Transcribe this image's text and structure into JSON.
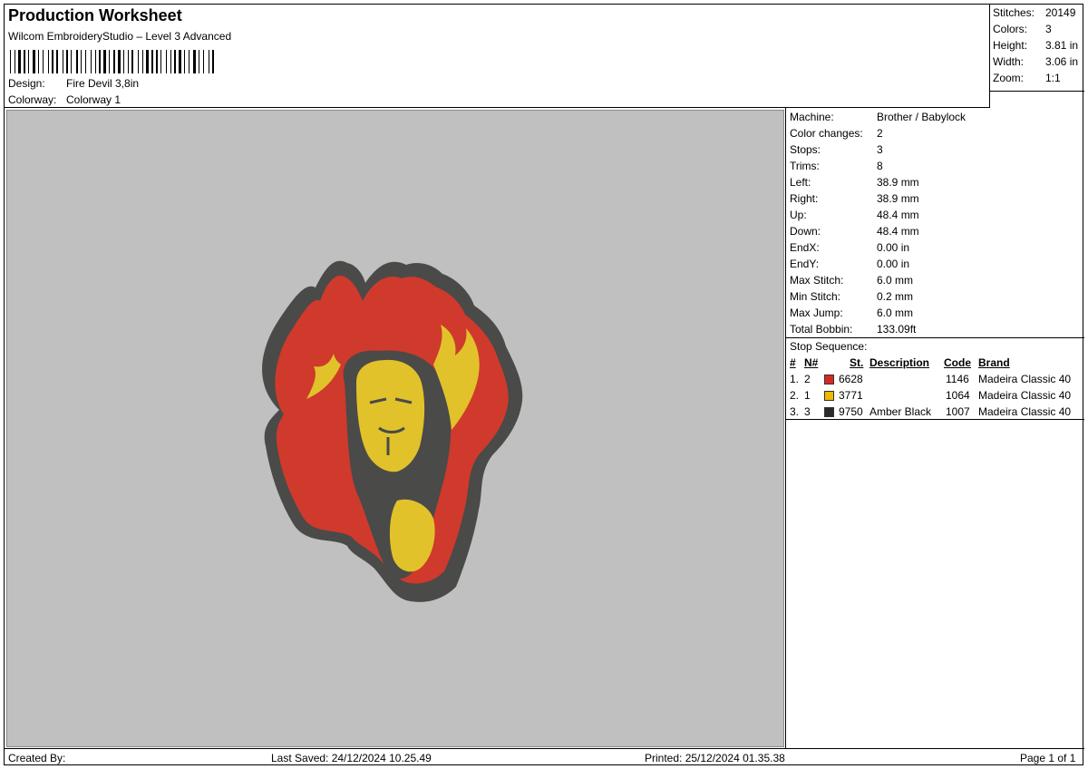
{
  "header": {
    "title": "Production Worksheet",
    "software": "Wilcom EmbroideryStudio – Level 3 Advanced",
    "design_label": "Design:",
    "design_value": "Fire Devil 3,8in",
    "colorway_label": "Colorway:",
    "colorway_value": "Colorway 1"
  },
  "summary": {
    "stitches_label": "Stitches:",
    "stitches_value": "20149",
    "colors_label": "Colors:",
    "colors_value": "3",
    "height_label": "Height:",
    "height_value": "3.81 in",
    "width_label": "Width:",
    "width_value": "3.06 in",
    "zoom_label": "Zoom:",
    "zoom_value": "1:1"
  },
  "machine_info": {
    "rows": [
      {
        "label": "Machine:",
        "value": "Brother / Babylock"
      },
      {
        "label": "Color changes:",
        "value": "2"
      },
      {
        "label": "Stops:",
        "value": "3"
      },
      {
        "label": "Trims:",
        "value": "8"
      },
      {
        "label": "Left:",
        "value": "38.9 mm"
      },
      {
        "label": "Right:",
        "value": "38.9 mm"
      },
      {
        "label": "Up:",
        "value": "48.4 mm"
      },
      {
        "label": "Down:",
        "value": "48.4 mm"
      },
      {
        "label": "EndX:",
        "value": "0.00 in"
      },
      {
        "label": "EndY:",
        "value": "0.00 in"
      },
      {
        "label": "Max Stitch:",
        "value": "6.0 mm"
      },
      {
        "label": "Min Stitch:",
        "value": "0.2 mm"
      },
      {
        "label": "Max Jump:",
        "value": "6.0 mm"
      },
      {
        "label": "Total Bobbin:",
        "value": "133.09ft"
      }
    ]
  },
  "stop_sequence": {
    "title": "Stop Sequence:",
    "columns": [
      "#",
      "N#",
      "St.",
      "Description",
      "Code",
      "Brand"
    ],
    "rows": [
      {
        "num": "1.",
        "n": "2",
        "color": "#d42a25",
        "st": "6628",
        "description": "",
        "code": "1146",
        "brand": "Madeira Classic 40"
      },
      {
        "num": "2.",
        "n": "1",
        "color": "#f0b800",
        "st": "3771",
        "description": "",
        "code": "1064",
        "brand": "Madeira Classic 40"
      },
      {
        "num": "3.",
        "n": "3",
        "color": "#2a2a2a",
        "st": "9750",
        "description": "Amber Black",
        "code": "1007",
        "brand": "Madeira Classic 40"
      }
    ]
  },
  "footer": {
    "created_by": "Created By:",
    "last_saved": "Last Saved: 24/12/2024 10.25.49",
    "printed": "Printed: 25/12/2024 01.35.38",
    "page": "Page 1 of 1"
  },
  "design_preview": {
    "icon": "fire-devil-embroidery",
    "colors": {
      "outline": "#4a4a48",
      "flame": "#cf3a2c",
      "face": "#e2c22a",
      "background": "#c0c0c0"
    }
  }
}
